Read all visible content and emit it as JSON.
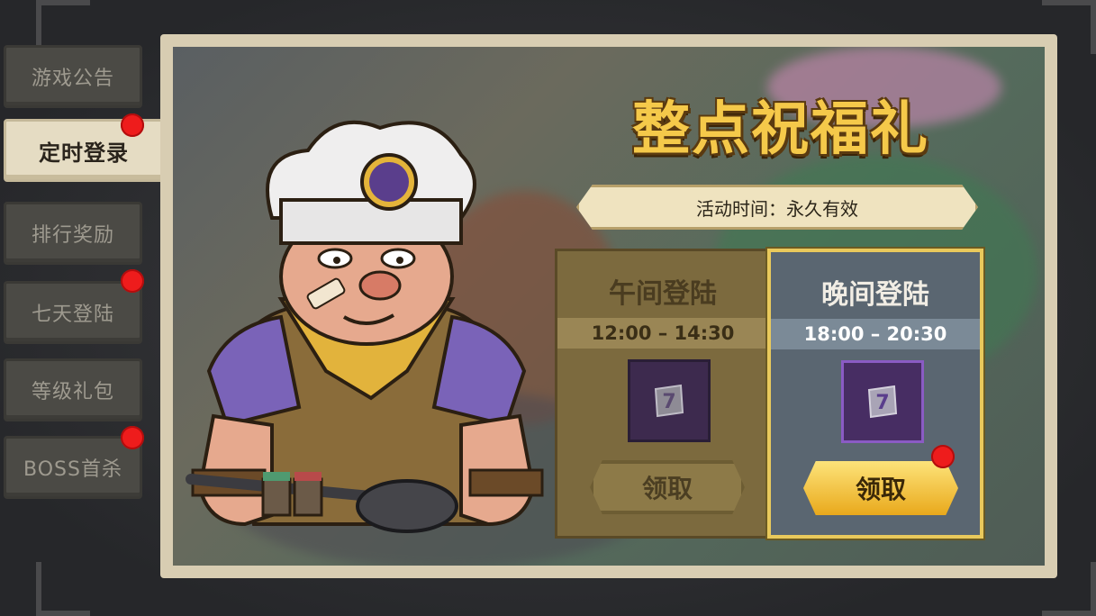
{
  "sidebar": {
    "tabs": [
      {
        "label": "游戏公告",
        "active": false,
        "notify": false
      },
      {
        "label": "定时登录",
        "active": true,
        "notify": true
      },
      {
        "label": "排行奖励",
        "active": false,
        "notify": false
      },
      {
        "label": "七天登陆",
        "active": false,
        "notify": true
      },
      {
        "label": "等级礼包",
        "active": false,
        "notify": false
      },
      {
        "label": "BOSS首杀",
        "active": false,
        "notify": true
      }
    ]
  },
  "event": {
    "title": "整点祝福礼",
    "time_text": "活动时间：永久有效"
  },
  "cards": {
    "noon": {
      "title": "午间登陆",
      "time": "12:00 – 14:30",
      "button": "领取",
      "reward_icon": "scroll-7-icon"
    },
    "evening": {
      "title": "晚间登陆",
      "time": "18:00 – 20:30",
      "button": "领取",
      "reward_icon": "scroll-7-icon"
    }
  },
  "colors": {
    "notify_dot": "#ee1c1c",
    "title_gold": "#f5c94a",
    "button_gold": "#e9a91c"
  }
}
